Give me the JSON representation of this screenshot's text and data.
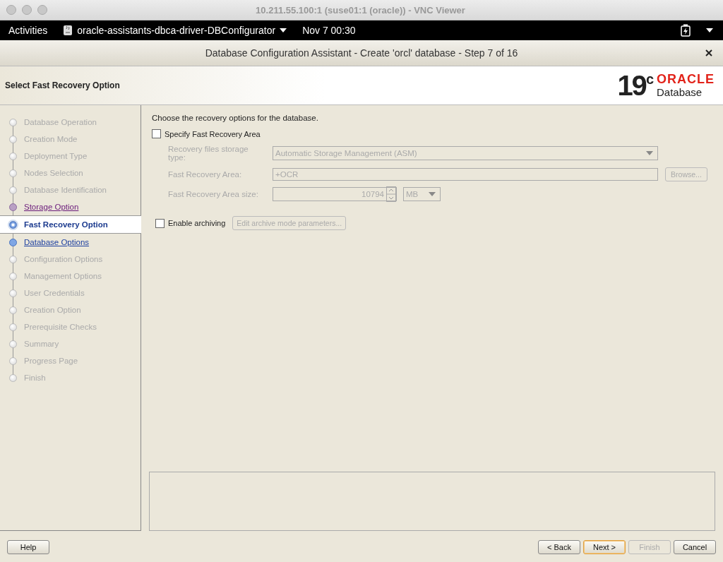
{
  "vnc_window": {
    "title": "10.211.55.100:1 (suse01:1 (oracle)) - VNC Viewer"
  },
  "top_bar": {
    "activities": "Activities",
    "app_menu": "oracle-assistants-dbca-driver-DBConfigurator",
    "clock": "Nov 7  00:30"
  },
  "dialog": {
    "title": "Database Configuration Assistant - Create 'orcl' database - Step 7 of 16",
    "header": "Select Fast Recovery Option",
    "logo": {
      "version": "19",
      "version_sup": "c",
      "brand": "ORACLE",
      "product": "Database"
    }
  },
  "steps": [
    {
      "label": "Database Operation",
      "enabled": false,
      "visited": false,
      "selected": false
    },
    {
      "label": "Creation Mode",
      "enabled": false,
      "visited": false,
      "selected": false
    },
    {
      "label": "Deployment Type",
      "enabled": false,
      "visited": false,
      "selected": false
    },
    {
      "label": "Nodes Selection",
      "enabled": false,
      "visited": false,
      "selected": false
    },
    {
      "label": "Database Identification",
      "enabled": false,
      "visited": false,
      "selected": false
    },
    {
      "label": "Storage Option",
      "enabled": true,
      "visited": true,
      "selected": false
    },
    {
      "label": "Fast Recovery Option",
      "enabled": true,
      "visited": false,
      "selected": true
    },
    {
      "label": "Database Options",
      "enabled": true,
      "visited": false,
      "selected": false
    },
    {
      "label": "Configuration Options",
      "enabled": false,
      "visited": false,
      "selected": false
    },
    {
      "label": "Management Options",
      "enabled": false,
      "visited": false,
      "selected": false
    },
    {
      "label": "User Credentials",
      "enabled": false,
      "visited": false,
      "selected": false
    },
    {
      "label": "Creation Option",
      "enabled": false,
      "visited": false,
      "selected": false
    },
    {
      "label": "Prerequisite Checks",
      "enabled": false,
      "visited": false,
      "selected": false
    },
    {
      "label": "Summary",
      "enabled": false,
      "visited": false,
      "selected": false
    },
    {
      "label": "Progress Page",
      "enabled": false,
      "visited": false,
      "selected": false
    },
    {
      "label": "Finish",
      "enabled": false,
      "visited": false,
      "selected": false
    }
  ],
  "content": {
    "intro": "Choose the recovery options for the database.",
    "specify_fra": {
      "label": "Specify Fast Recovery Area",
      "checked": false
    },
    "storage_type": {
      "label": "Recovery files storage type:",
      "value": "Automatic Storage Management (ASM)",
      "disabled": true
    },
    "fra_location": {
      "label": "Fast Recovery Area:",
      "value": "+OCR",
      "disabled": true,
      "browse": "Browse..."
    },
    "fra_size": {
      "label": "Fast Recovery Area size:",
      "value": "10794",
      "unit": "MB",
      "disabled": true
    },
    "archiving": {
      "label": "Enable archiving",
      "checked": false,
      "button": "Edit archive mode parameters...",
      "disabled": true
    }
  },
  "buttons": [
    {
      "label": "Help",
      "disabled": false,
      "default": false
    },
    {
      "label": "< Back",
      "disabled": false,
      "default": false
    },
    {
      "label": "Next >",
      "disabled": false,
      "default": true
    },
    {
      "label": "Finish",
      "disabled": true,
      "default": false
    },
    {
      "label": "Cancel",
      "disabled": false,
      "default": false
    }
  ]
}
